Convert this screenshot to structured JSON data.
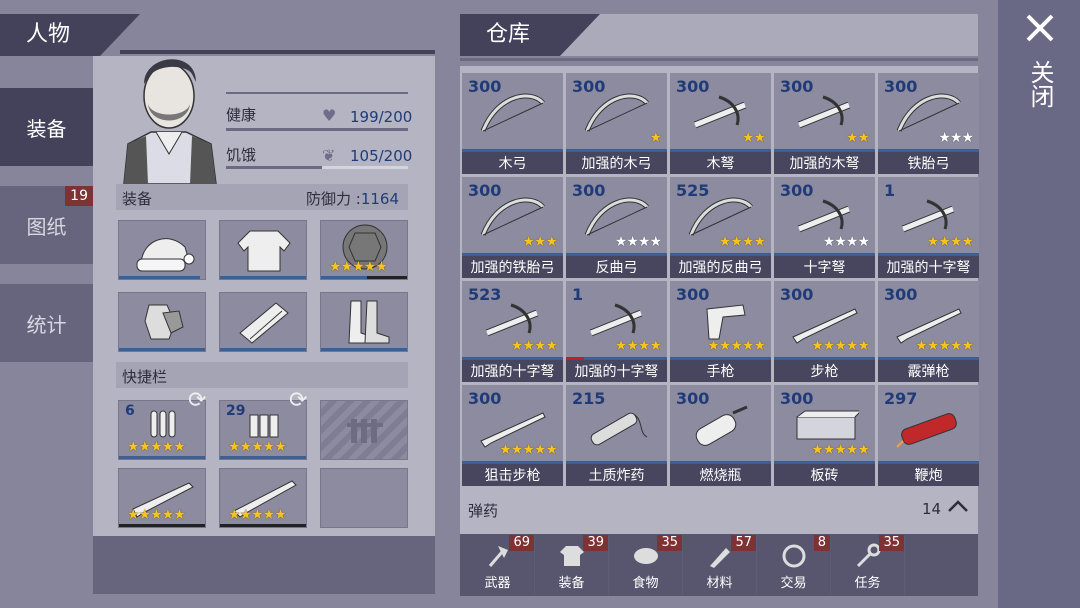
{
  "character": {
    "title": "人物",
    "health_label": "健康",
    "health_value": "199/200",
    "health_pct": 0.995,
    "hunger_label": "饥饿",
    "hunger_value": "105/200",
    "hunger_pct": 0.525
  },
  "sidebar": {
    "tabs": [
      {
        "label": "装备",
        "active": true
      },
      {
        "label": "图纸",
        "badge": "19"
      },
      {
        "label": "统计"
      }
    ]
  },
  "equipment": {
    "label": "装备",
    "defense_label": "防御力 :",
    "defense_value": "1164",
    "slots": [
      {
        "icon": "santa-hat-icon"
      },
      {
        "icon": "shirt-icon"
      },
      {
        "icon": "turtle-shell-icon",
        "stars": 5
      },
      {
        "icon": "gloves-icon"
      },
      {
        "icon": "pants-icon"
      },
      {
        "icon": "boots-icon"
      }
    ]
  },
  "quickbar": {
    "label": "快捷栏",
    "slots": [
      {
        "icon": "bullets-icon",
        "count": "6",
        "stars": 5
      },
      {
        "icon": "shells-icon",
        "count": "29",
        "stars": 5
      },
      {
        "icon": "locked-slot-icon"
      },
      {
        "icon": "rifle-icon",
        "stars": 5
      },
      {
        "icon": "shotgun-icon",
        "stars": 5
      },
      {
        "icon": "empty-slot"
      }
    ]
  },
  "warehouse": {
    "title": "仓库",
    "items": [
      {
        "count": "300",
        "name": "木弓",
        "stars": 0,
        "art": "bow"
      },
      {
        "count": "300",
        "name": "加强的木弓",
        "stars": 1,
        "art": "bow"
      },
      {
        "count": "300",
        "name": "木弩",
        "stars": 2,
        "white": 2,
        "art": "crossbow"
      },
      {
        "count": "300",
        "name": "加强的木弩",
        "stars": 2,
        "art": "crossbow"
      },
      {
        "count": "300",
        "name": "铁胎弓",
        "stars": 0,
        "white": 3,
        "art": "bow"
      },
      {
        "count": "300",
        "name": "加强的铁胎弓",
        "stars": 3,
        "art": "bow"
      },
      {
        "count": "300",
        "name": "反曲弓",
        "stars": 0,
        "white": 4,
        "art": "bow"
      },
      {
        "count": "525",
        "name": "加强的反曲弓",
        "stars": 4,
        "art": "bow"
      },
      {
        "count": "300",
        "name": "十字弩",
        "stars": 0,
        "white": 4,
        "art": "crossbow"
      },
      {
        "count": "1",
        "name": "加强的十字弩",
        "stars": 4,
        "art": "crossbow"
      },
      {
        "count": "523",
        "name": "加强的十字弩",
        "stars": 4,
        "art": "crossbow"
      },
      {
        "count": "1",
        "name": "加强的十字弩",
        "stars": 4,
        "art": "crossbow",
        "damaged": true
      },
      {
        "count": "300",
        "name": "手枪",
        "stars": 5,
        "art": "pistol"
      },
      {
        "count": "300",
        "name": "步枪",
        "stars": 5,
        "art": "rifle"
      },
      {
        "count": "300",
        "name": "霰弹枪",
        "stars": 5,
        "art": "rifle"
      },
      {
        "count": "300",
        "name": "狙击步枪",
        "stars": 5,
        "art": "rifle"
      },
      {
        "count": "215",
        "name": "土质炸药",
        "stars": 0,
        "art": "dynamite"
      },
      {
        "count": "300",
        "name": "燃烧瓶",
        "stars": 0,
        "art": "bottle"
      },
      {
        "count": "300",
        "name": "板砖",
        "stars": 5,
        "art": "brick"
      },
      {
        "count": "297",
        "name": "鞭炮",
        "stars": 0,
        "art": "firecracker"
      }
    ],
    "ammo_label": "弹药",
    "ammo_count": "14",
    "categories": [
      {
        "label": "武器",
        "badge": "69",
        "icon": "axe-icon"
      },
      {
        "label": "装备",
        "badge": "39",
        "icon": "shirt-icon"
      },
      {
        "label": "食物",
        "badge": "35",
        "icon": "meat-icon"
      },
      {
        "label": "材料",
        "badge": "57",
        "icon": "wood-icon"
      },
      {
        "label": "交易",
        "badge": "8",
        "icon": "coin-icon"
      },
      {
        "label": "任务",
        "badge": "35",
        "icon": "key-icon"
      }
    ]
  },
  "close": {
    "label": "关闭",
    "icon": "close-icon"
  },
  "colors": {
    "panel": "#b4b4c3",
    "header": "#43425a",
    "star": "#f5c322",
    "count": "#1f3b78",
    "badge": "#7d3333"
  }
}
